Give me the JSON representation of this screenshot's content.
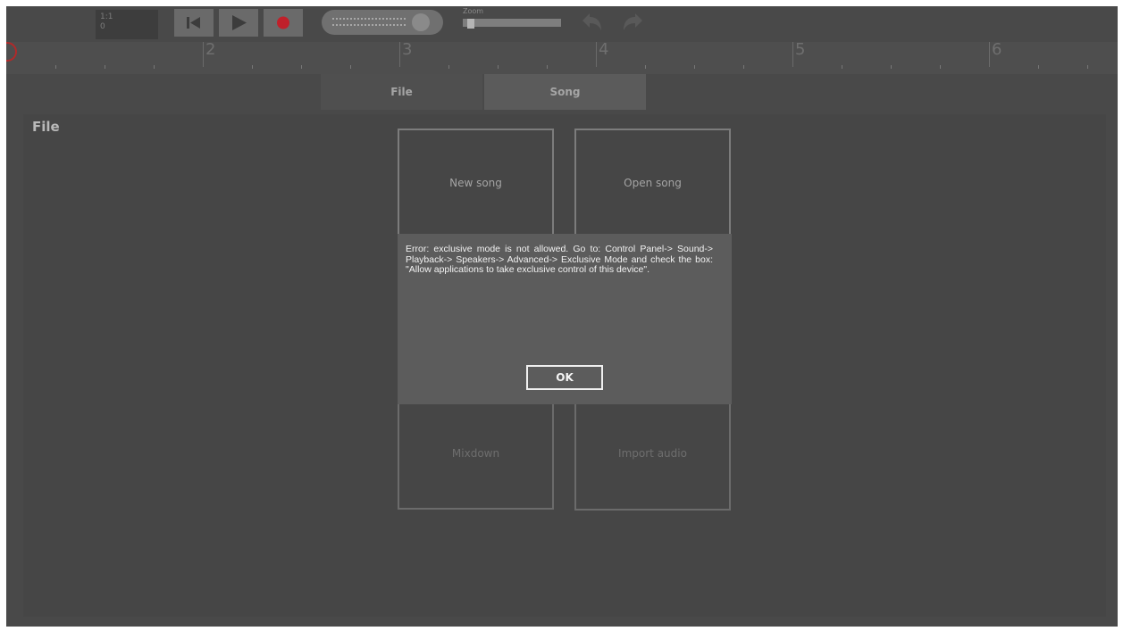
{
  "toolbar": {
    "position_bar_beat": "1:1",
    "position_tick": "0",
    "zoom_label": "Zoom",
    "zoom_level": 0.02,
    "record_color": "#c0202a"
  },
  "ruler": {
    "bars": [
      "2",
      "3",
      "4",
      "5",
      "6"
    ]
  },
  "tabs": [
    {
      "label": "File",
      "active": true
    },
    {
      "label": "Song",
      "active": false
    }
  ],
  "panel": {
    "title": "File",
    "tiles": {
      "new_song": "New song",
      "open_song": "Open song",
      "mixdown": "Mixdown",
      "import_audio": "Import audio"
    }
  },
  "dialog": {
    "message": "Error: exclusive mode is not allowed. Go to: Control Panel-> Sound-> Playback-> Speakers-> Advanced-> Exclusive Mode and check the box: \"Allow applications to take exclusive control of this device\".",
    "ok_label": "OK"
  }
}
